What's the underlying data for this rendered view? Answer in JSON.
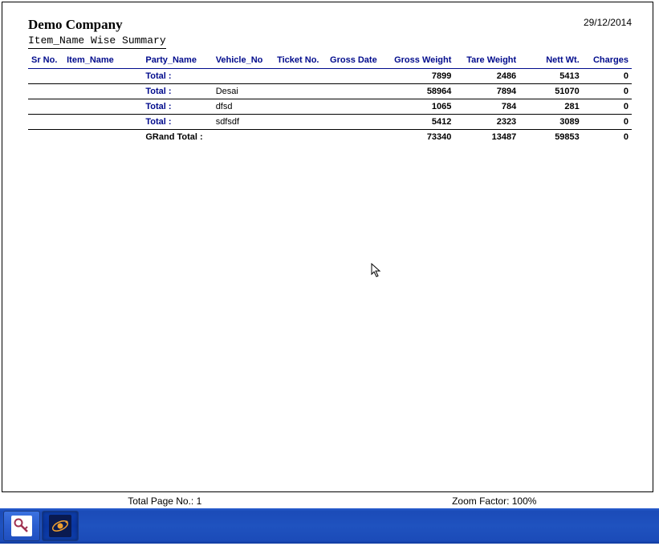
{
  "header": {
    "company": "Demo Company",
    "subtitle": "Item_Name Wise Summary",
    "date": "29/12/2014"
  },
  "columns": {
    "srno": "Sr No.",
    "item": "Item_Name",
    "party": "Party_Name",
    "vehicle": "Vehicle_No",
    "ticket": "Ticket No.",
    "grossdate": "Gross Date",
    "grossweight": "Gross Weight",
    "tareweight": "Tare Weight",
    "nettwt": "Nett Wt.",
    "charges": "Charges"
  },
  "rows": [
    {
      "label": "Total :",
      "vehicle": "",
      "gross": "7899",
      "tare": "2486",
      "nett": "5413",
      "charges": "0"
    },
    {
      "label": "Total :",
      "vehicle": "Desai",
      "gross": "58964",
      "tare": "7894",
      "nett": "51070",
      "charges": "0"
    },
    {
      "label": "Total :",
      "vehicle": "dfsd",
      "gross": "1065",
      "tare": "784",
      "nett": "281",
      "charges": "0"
    },
    {
      "label": "Total :",
      "vehicle": "sdfsdf",
      "gross": "5412",
      "tare": "2323",
      "nett": "3089",
      "charges": "0"
    }
  ],
  "grand": {
    "label": "GRand Total :",
    "gross": "73340",
    "tare": "13487",
    "nett": "59853",
    "charges": "0"
  },
  "status": {
    "page": "Total Page No.: 1",
    "zoom": "Zoom Factor: 100%"
  }
}
